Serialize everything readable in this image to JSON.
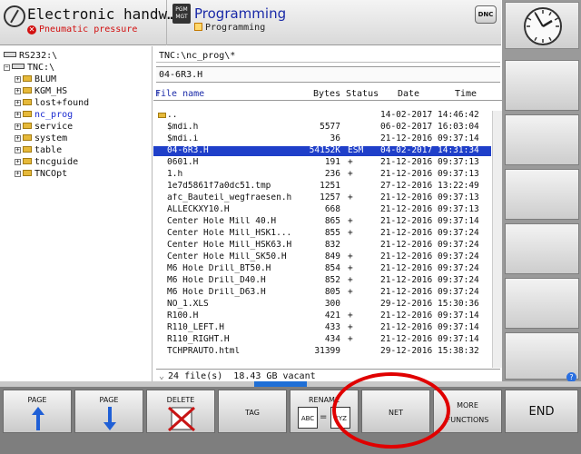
{
  "header": {
    "mode_title": "Electronic handw…",
    "alert_text": "Pneumatic pressure",
    "pgm_badge": "PGM MGT",
    "program_title": "Programming",
    "program_subtitle": "Programming",
    "dnc_label": "DNC"
  },
  "tree": {
    "nodes": [
      {
        "label": "RS232:\\"
      },
      {
        "label": "TNC:\\"
      },
      {
        "label": "BLUM"
      },
      {
        "label": "KGM_HS"
      },
      {
        "label": "lost+found"
      },
      {
        "label": "nc_prog"
      },
      {
        "label": "service"
      },
      {
        "label": "system"
      },
      {
        "label": "table"
      },
      {
        "label": "tncguide"
      },
      {
        "label": "TNCOpt"
      }
    ]
  },
  "files": {
    "path": "TNC:\\nc_prog\\*",
    "current_file": "04-6R3.H",
    "columns": {
      "name": "File name",
      "bytes": "Bytes",
      "status": "Status",
      "date": "Date",
      "time": "Time"
    },
    "rows": [
      {
        "name": "..",
        "bytes": "",
        "status": "",
        "date": "14-02-2017",
        "time": "14:46:42"
      },
      {
        "name": "$mdi.h",
        "bytes": "5577",
        "status": "",
        "date": "06-02-2017",
        "time": "16:03:04"
      },
      {
        "name": "$mdi.i",
        "bytes": "36",
        "status": "",
        "date": "21-12-2016",
        "time": "09:37:14"
      },
      {
        "name": "04-6R3.H",
        "bytes": "54152K",
        "status": "ESM",
        "date": "04-02-2017",
        "time": "14:31:34"
      },
      {
        "name": "0601.H",
        "bytes": "191",
        "status": "+",
        "date": "21-12-2016",
        "time": "09:37:13"
      },
      {
        "name": "1.h",
        "bytes": "236",
        "status": "+",
        "date": "21-12-2016",
        "time": "09:37:13"
      },
      {
        "name": "1e7d5861f7a0dc51.tmp",
        "bytes": "1251",
        "status": "",
        "date": "27-12-2016",
        "time": "13:22:49"
      },
      {
        "name": "afc_Bauteil_wegfraesen.h",
        "bytes": "1257",
        "status": "+",
        "date": "21-12-2016",
        "time": "09:37:13"
      },
      {
        "name": "ALLECKXY10.H",
        "bytes": "668",
        "status": "",
        "date": "21-12-2016",
        "time": "09:37:13"
      },
      {
        "name": "Center Hole Mill 40.H",
        "bytes": "865",
        "status": "+",
        "date": "21-12-2016",
        "time": "09:37:14"
      },
      {
        "name": "Center Hole Mill_HSK1...",
        "bytes": "855",
        "status": "+",
        "date": "21-12-2016",
        "time": "09:37:24"
      },
      {
        "name": "Center Hole Mill_HSK63.H",
        "bytes": "832",
        "status": "",
        "date": "21-12-2016",
        "time": "09:37:24"
      },
      {
        "name": "Center Hole Mill_SK50.H",
        "bytes": "849",
        "status": "+",
        "date": "21-12-2016",
        "time": "09:37:24"
      },
      {
        "name": "M6 Hole Drill_BT50.H",
        "bytes": "854",
        "status": "+",
        "date": "21-12-2016",
        "time": "09:37:24"
      },
      {
        "name": "M6 Hole Drill_D40.H",
        "bytes": "852",
        "status": "+",
        "date": "21-12-2016",
        "time": "09:37:24"
      },
      {
        "name": "M6 Hole Drill_D63.H",
        "bytes": "805",
        "status": "+",
        "date": "21-12-2016",
        "time": "09:37:24"
      },
      {
        "name": "NO_1.XLS",
        "bytes": "300",
        "status": "",
        "date": "29-12-2016",
        "time": "15:30:36"
      },
      {
        "name": "R100.H",
        "bytes": "421",
        "status": "+",
        "date": "21-12-2016",
        "time": "09:37:14"
      },
      {
        "name": "R110_LEFT.H",
        "bytes": "433",
        "status": "+",
        "date": "21-12-2016",
        "time": "09:37:14"
      },
      {
        "name": "R110_RIGHT.H",
        "bytes": "434",
        "status": "+",
        "date": "21-12-2016",
        "time": "09:37:14"
      },
      {
        "name": "TCHPRAUTO.html",
        "bytes": "31399",
        "status": "",
        "date": "29-12-2016",
        "time": "15:38:32"
      }
    ],
    "selected_index": 3,
    "footer_count": "24",
    "footer_text": "file(s)",
    "footer_space": "18.43 GB vacant"
  },
  "softkeys": {
    "page_up": "PAGE",
    "page_down": "PAGE",
    "delete": "DELETE",
    "tag": "TAG",
    "rename": "RENAME",
    "rename_from": "ABC",
    "rename_to": "XYZ",
    "net": "NET",
    "more_1": "MORE",
    "more_2": "FUNCTIONS",
    "end": "END"
  },
  "colors": {
    "selection": "#1f3fc9",
    "alert": "#d21010",
    "annotation_circle": "#e00000",
    "title_blue": "#1a2aa8"
  },
  "progress_strip_fill": 0.09
}
